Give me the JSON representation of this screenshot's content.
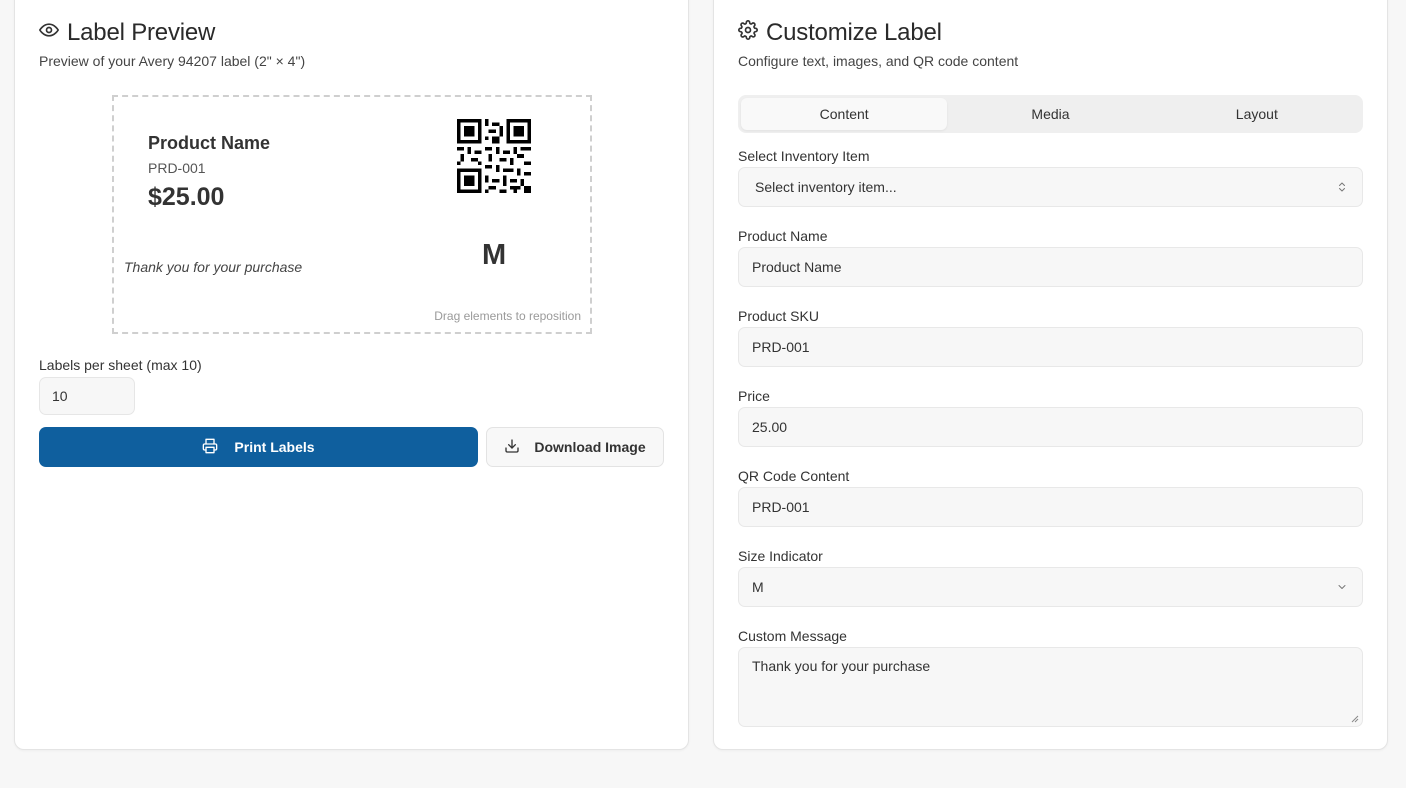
{
  "preview": {
    "title": "Label Preview",
    "subtitle": "Preview of your Avery 94207 label (2\" × 4\")",
    "label": {
      "product_name": "Product Name",
      "sku": "PRD-001",
      "price": "$25.00",
      "message": "Thank you for your purchase",
      "size": "M",
      "hint": "Drag elements to reposition"
    },
    "labels_per_sheet_label": "Labels per sheet (max 10)",
    "labels_per_sheet_value": "10",
    "print_button": "Print Labels",
    "download_button": "Download Image"
  },
  "customize": {
    "title": "Customize Label",
    "subtitle": "Configure text, images, and QR code content",
    "tabs": [
      {
        "label": "Content",
        "active": true
      },
      {
        "label": "Media",
        "active": false
      },
      {
        "label": "Layout",
        "active": false
      }
    ],
    "fields": {
      "inventory": {
        "label": "Select Inventory Item",
        "value": "Select inventory item..."
      },
      "product_name": {
        "label": "Product Name",
        "value": "Product Name"
      },
      "sku": {
        "label": "Product SKU",
        "value": "PRD-001"
      },
      "price": {
        "label": "Price",
        "value": "25.00"
      },
      "qr": {
        "label": "QR Code Content",
        "value": "PRD-001"
      },
      "size": {
        "label": "Size Indicator",
        "value": "M"
      },
      "message": {
        "label": "Custom Message",
        "value": "Thank you for your purchase"
      }
    }
  },
  "icons": {
    "preview": "eye-icon",
    "customize": "gear-icon",
    "print": "printer-icon",
    "download": "download-icon",
    "select": "chevron-up-down-icon",
    "dropdown": "chevron-down-icon"
  },
  "colors": {
    "primary": "#0f5f9e",
    "background": "#f7f7f7"
  }
}
